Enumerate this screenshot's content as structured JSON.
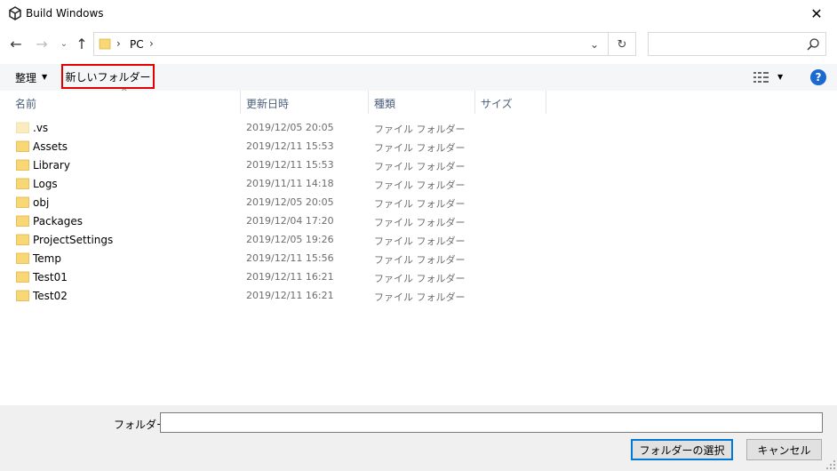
{
  "window": {
    "title": "Build Windows"
  },
  "address": {
    "segments": [
      "PC"
    ]
  },
  "search": {
    "placeholder": ""
  },
  "toolbar": {
    "organize_label": "整理",
    "new_folder_label": "新しいフォルダー"
  },
  "columns": {
    "name": "名前",
    "date": "更新日時",
    "type": "種類",
    "size": "サイズ"
  },
  "files": [
    {
      "name": ".vs",
      "date": "2019/12/05 20:05",
      "type": "ファイル フォルダー",
      "hidden": true
    },
    {
      "name": "Assets",
      "date": "2019/12/11 15:53",
      "type": "ファイル フォルダー"
    },
    {
      "name": "Library",
      "date": "2019/12/11 15:53",
      "type": "ファイル フォルダー"
    },
    {
      "name": "Logs",
      "date": "2019/11/11 14:18",
      "type": "ファイル フォルダー"
    },
    {
      "name": "obj",
      "date": "2019/12/05 20:05",
      "type": "ファイル フォルダー"
    },
    {
      "name": "Packages",
      "date": "2019/12/04 17:20",
      "type": "ファイル フォルダー"
    },
    {
      "name": "ProjectSettings",
      "date": "2019/12/05 19:26",
      "type": "ファイル フォルダー"
    },
    {
      "name": "Temp",
      "date": "2019/12/11 15:56",
      "type": "ファイル フォルダー"
    },
    {
      "name": "Test01",
      "date": "2019/12/11 16:21",
      "type": "ファイル フォルダー"
    },
    {
      "name": "Test02",
      "date": "2019/12/11 16:21",
      "type": "ファイル フォルダー"
    }
  ],
  "footer": {
    "folder_label": "フォルダー:",
    "folder_value": "",
    "select_label": "フォルダーの選択",
    "cancel_label": "キャンセル"
  },
  "colors": {
    "accent": "#0078d7",
    "highlight_border": "#e50000",
    "help": "#1a6ad0",
    "folder": "#f8d775"
  }
}
